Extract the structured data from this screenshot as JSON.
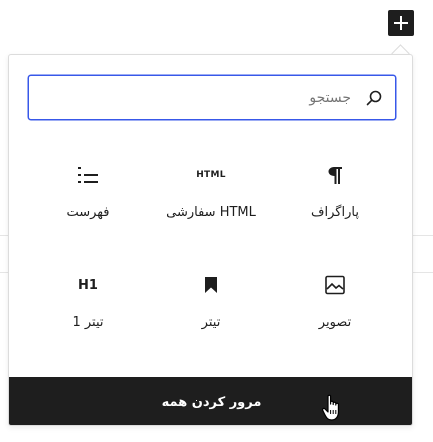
{
  "toolbar": {
    "add_block_label": "+"
  },
  "inserter": {
    "search": {
      "placeholder": "جستجو",
      "value": ""
    },
    "blocks": [
      {
        "label": "پاراگراف",
        "icon": "paragraph-icon"
      },
      {
        "label": "HTML سفارشی",
        "icon": "html-icon",
        "icon_text": "HTML"
      },
      {
        "label": "فهرست",
        "icon": "list-icon"
      },
      {
        "label": "تصویر",
        "icon": "image-icon"
      },
      {
        "label": "تیتر",
        "icon": "bookmark-icon"
      },
      {
        "label": "تیتر 1",
        "icon": "heading-icon",
        "icon_text": "H1"
      }
    ],
    "browse_all_label": "مرور کردن همه"
  },
  "colors": {
    "accent": "#3858e9",
    "dark": "#1e1e1e"
  }
}
